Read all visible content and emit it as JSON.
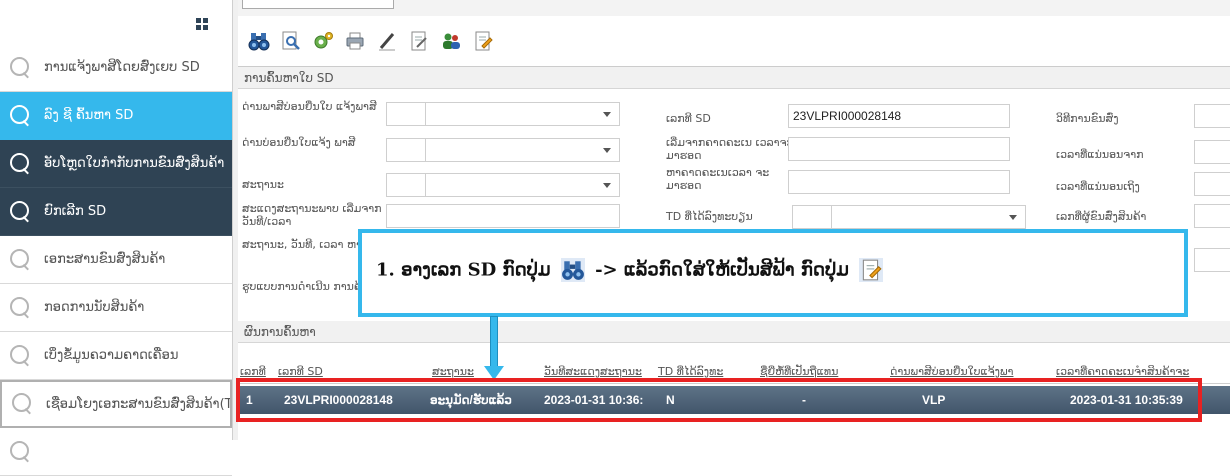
{
  "sidebar": {
    "items": [
      {
        "label": "ການແຈ້ງພາສີໂດຍສົ່ງເຍບ SD"
      },
      {
        "label": "ລົງ ຊີ ຄົ້ນຫາ SD"
      },
      {
        "label": "ອັບໂຫຼດໃບກຳກັບການຂົນສົ່ງສິນຄ້າ"
      },
      {
        "label": "ຍົກເລີກ SD"
      },
      {
        "label": "ເອກະສານຂົນສົ່ງສິນຄ້າ"
      },
      {
        "label": "ກອດການນັບສິນຄ້າ"
      },
      {
        "label": "ເບິ່ງຂໍ້ມູນຄວາມຄາດເຄື່ອນ"
      },
      {
        "label": "ເຊື່ອມໂຍງເອກະສານຂົນສົ່ງສິນຄ້າ(T"
      }
    ]
  },
  "toolbar": {
    "icons": [
      "binoculars-icon",
      "preview-icon",
      "settings-icon",
      "print-icon",
      "edit-icon",
      "document-icon",
      "users-icon",
      "approve-document-icon"
    ]
  },
  "search_section": {
    "title": "ການຄົ້ນຫາໃບ SD"
  },
  "form": {
    "tax_office_label": "ດ່ານພາສີບ່ອນຍື່ນໃບ ແຈ້ງພາສີ",
    "declare_office_label": "ດ່ານບ່ອນຍື່ນໃບແຈ້ງ ພາສີ",
    "status_label": "ສະຖານະ",
    "status_date_label": "ສະແດງສະຖານະພາບ ເລີ່ມຈາກວັນທີ/ເວລາ",
    "status_date2_label": "ສະຖານະ, ວັນທີ, ເວລາ ຫາ",
    "method_label": "ຮູບແບບການດຳເນີນ ການຄ້າ",
    "sd_no_label": "ເລກທີ SD",
    "sd_no_value": "23VLPRI000028148",
    "from_time_label": "ເລີ່ມຈາກຄາດຄະເນ ເວລາຈະມາຮອດ",
    "to_time_label": "ຫາຄາດຄະເນເວລາ ຈະມາຮອດ",
    "td_label": "TD ທີ່ໄດ້ລົງທະບຽນ",
    "transport_label": "ວິທີການຂົນສົ່ງ",
    "accept_from_label": "ເວລາທີ່ແນ່ນອນຈາກ",
    "accept_to_label": "ເວລາທີ່ແນ່ນອນເຖິງ",
    "goods_no_label": "ເລກທີ່ຜູ້ຂົນສົ່ງສິນຄ້າ"
  },
  "results_section": {
    "title": "ຜົນການຄົ້ນຫາ"
  },
  "table": {
    "headers": [
      "ເລກທີ",
      "ເລກທີ SD",
      "ສະຖານະ",
      "ວັນທີສະແດງສະຖານະ",
      "TD ທີ່ໄດ້ລົງທະ",
      "ຊື່ຍີ່ຫໍ້ທີ່ເປັນຖືແທນ",
      "ດ່ານພາສີບ່ອນຍື່ນໃບແຈ້ງພາ",
      "ເວລາທີ່ຄາດຄະເນຈຳສິນຄ້າຈະ"
    ],
    "rows": [
      [
        "1",
        "23VLPRI000028148",
        "ອະນຸມັດ/ຮັບແລ້ວ",
        "2023-01-31 10:36:",
        "N",
        "-",
        "VLP",
        "2023-01-31 10:35:39"
      ]
    ]
  },
  "callout": {
    "number": "1.",
    "text_before": "ອາງເລກ SD ກົດປຸ່ມ",
    "text_middle": "-> ແລ້ວກົດໃສ່ໃຫ້ເປັນສີຟ້າ ກົດປຸ່ມ",
    "icon_1": "binoculars-icon",
    "icon_2": "approve-document-icon"
  },
  "colors": {
    "active_item": "#35b8ec",
    "dark_item": "#2f4354",
    "highlight_red": "#e82222",
    "selected_row": "#4c6075"
  }
}
